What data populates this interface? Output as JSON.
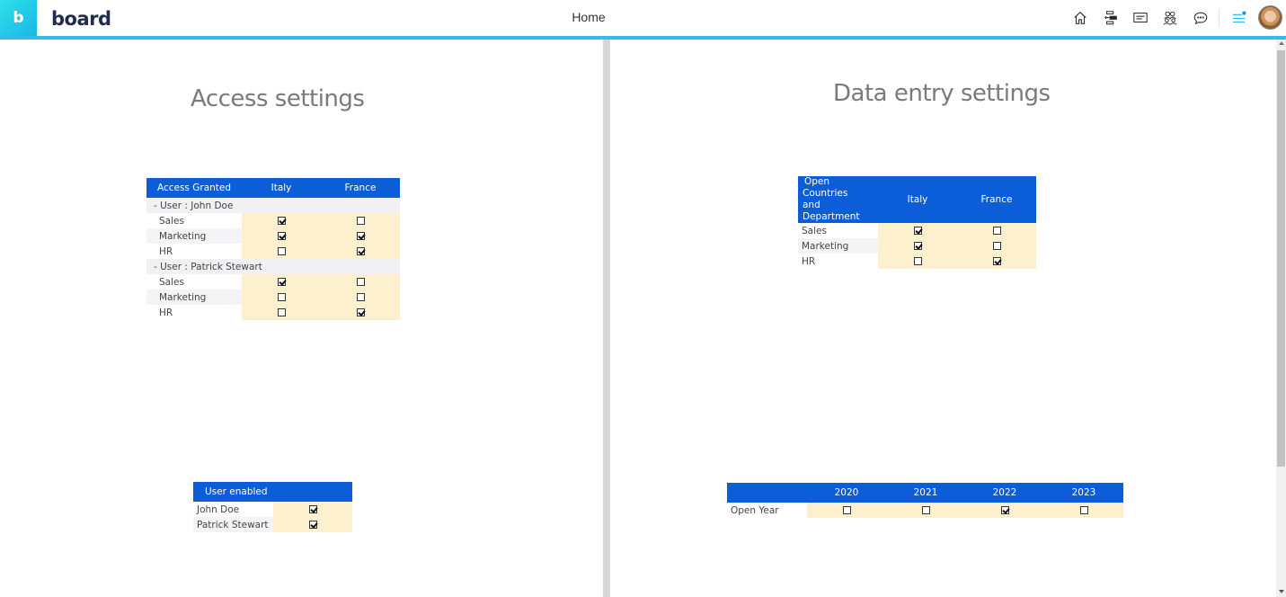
{
  "app": {
    "brand": "board",
    "logo_letter": "b",
    "page_title": "Home",
    "accent_color": "#30bcec",
    "header_color": "#0b5ed7",
    "cell_color": "#fdf0cf"
  },
  "toolbar": {
    "icons": [
      "home-icon",
      "hierarchy-icon",
      "message-icon",
      "people-icon",
      "chat-icon",
      "menu-notification-icon",
      "user-avatar"
    ]
  },
  "access": {
    "title": "Access settings",
    "table": {
      "columns": [
        "Access Granted",
        "Italy",
        "France"
      ],
      "groups": [
        {
          "label": "-  User : John Doe",
          "rows": [
            {
              "label": "Sales",
              "italy": true,
              "france": false
            },
            {
              "label": "Marketing",
              "italy": true,
              "france": true
            },
            {
              "label": "HR",
              "italy": false,
              "france": true
            }
          ]
        },
        {
          "label": "-  User : Patrick Stewart",
          "rows": [
            {
              "label": "Sales",
              "italy": true,
              "france": false
            },
            {
              "label": "Marketing",
              "italy": false,
              "france": false
            },
            {
              "label": "HR",
              "italy": false,
              "france": true
            }
          ]
        }
      ]
    },
    "user_enabled": {
      "header": "User enabled",
      "rows": [
        {
          "label": "John Doe",
          "enabled": true
        },
        {
          "label": "Patrick Stewart",
          "enabled": true
        }
      ]
    }
  },
  "data_entry": {
    "title": "Data entry settings",
    "table": {
      "header_line1": "Open Countries",
      "header_line2": "and Department",
      "columns": [
        "Italy",
        "France"
      ],
      "rows": [
        {
          "label": "Sales",
          "italy": true,
          "france": false
        },
        {
          "label": "Marketing",
          "italy": true,
          "france": false
        },
        {
          "label": "HR",
          "italy": false,
          "france": true
        }
      ]
    },
    "open_year": {
      "columns": [
        "2020",
        "2021",
        "2022",
        "2023"
      ],
      "row_label": "Open Year",
      "values": [
        false,
        false,
        true,
        false
      ]
    }
  }
}
